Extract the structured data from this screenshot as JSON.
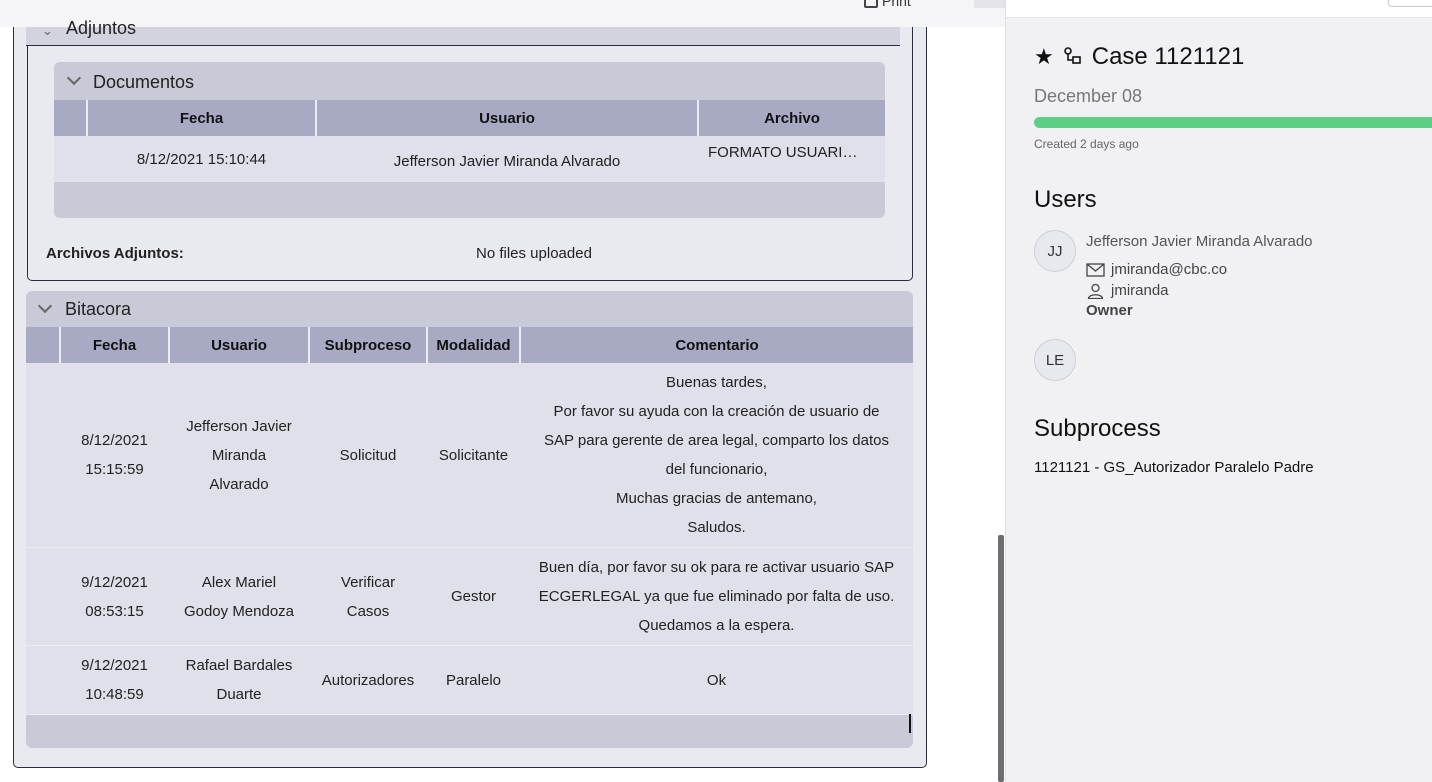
{
  "toolbar": {
    "print_label": "Print"
  },
  "adjuntos": {
    "title": "Adjuntos",
    "documentos": {
      "title": "Documentos",
      "columns": [
        "Fecha",
        "Usuario",
        "Archivo"
      ],
      "rows": [
        {
          "fecha": "8/12/2021 15:10:44",
          "usuario": "Jefferson Javier Miranda Alvarado",
          "archivo": "FORMATO USUARI…"
        }
      ]
    },
    "archivos_label": "Archivos Adjuntos:",
    "archivos_value": "No files uploaded"
  },
  "bitacora": {
    "title": "Bitacora",
    "columns": [
      "Fecha",
      "Usuario",
      "Subproceso",
      "Modalidad",
      "Comentario"
    ],
    "rows": [
      {
        "fecha": [
          "8/12/2021",
          "15:15:59"
        ],
        "usuario": [
          "Jefferson Javier",
          "Miranda",
          "Alvarado"
        ],
        "subproceso": [
          "Solicitud"
        ],
        "modalidad": [
          "Solicitante"
        ],
        "comentario": [
          "Buenas tardes,",
          "Por favor su ayuda con la creación de usuario de",
          "SAP para gerente de area legal, comparto los datos",
          "del funcionario,",
          "Muchas gracias de antemano,",
          "Saludos."
        ]
      },
      {
        "fecha": [
          "9/12/2021",
          "08:53:15"
        ],
        "usuario": [
          "Alex Mariel",
          "Godoy Mendoza"
        ],
        "subproceso": [
          "Verificar",
          "Casos"
        ],
        "modalidad": [
          "Gestor"
        ],
        "comentario": [
          "Buen día, por favor su ok para re activar usuario SAP",
          "ECGERLEGAL ya que fue eliminado por falta de uso.",
          "Quedamos a la espera."
        ]
      },
      {
        "fecha": [
          "9/12/2021",
          "10:48:59"
        ],
        "usuario": [
          "Rafael Bardales",
          "Duarte"
        ],
        "subproceso": [
          "Autorizadores"
        ],
        "modalidad": [
          "Paralelo"
        ],
        "comentario": [
          "Ok"
        ]
      }
    ]
  },
  "sidebar": {
    "case_title": "Case 1121121",
    "date": "December 08",
    "progress": 1.0,
    "created": "Created 2 days ago",
    "users_title": "Users",
    "users": [
      {
        "initials": "JJ",
        "name": "Jefferson Javier Miranda Alvarado",
        "email": "jmiranda@cbc.co",
        "username": "jmiranda",
        "role": "Owner"
      },
      {
        "initials": "LE"
      }
    ],
    "subprocess_title": "Subprocess",
    "subprocess_value": "1121121 - GS_Autorizador Paralelo Padre",
    "icons": [
      "star-icon",
      "flow-icon",
      "mail-icon",
      "user-icon"
    ],
    "colors": {
      "progress": "#5dcf85",
      "panel": "#c9cad8",
      "header": "#a8aac3"
    }
  }
}
